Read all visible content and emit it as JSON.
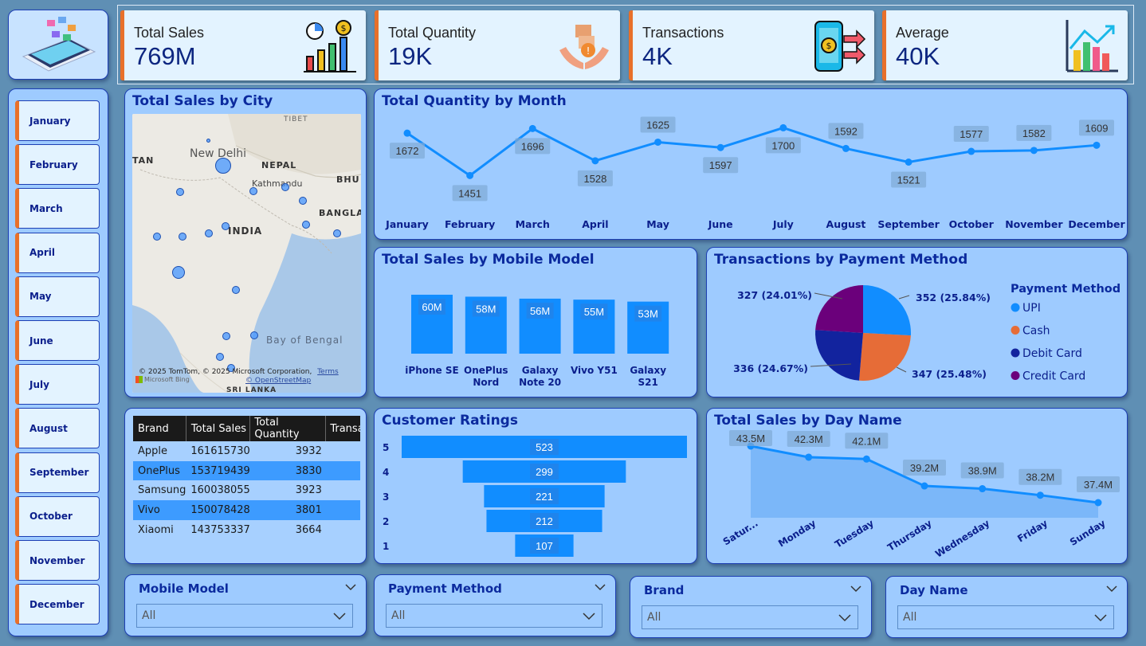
{
  "kpis": [
    {
      "label": "Total Sales",
      "value": "769M",
      "icon": "sales-bar-chart-icon"
    },
    {
      "label": "Total Quantity",
      "value": "19K",
      "icon": "package-hands-icon"
    },
    {
      "label": "Transactions",
      "value": "4K",
      "icon": "phone-payment-icon"
    },
    {
      "label": "Average",
      "value": "40K",
      "icon": "growth-chart-icon"
    }
  ],
  "months": [
    "January",
    "February",
    "March",
    "April",
    "May",
    "June",
    "July",
    "August",
    "September",
    "October",
    "November",
    "December"
  ],
  "city_map": {
    "title": "Total Sales by City",
    "labels": [
      "TIBET",
      "New Delhi",
      "TAN",
      "NEPAL",
      "Kathmandu",
      "BHU",
      "BANGLA",
      "INDIA",
      "Bay of Bengal",
      "SRI LANKA"
    ],
    "attribution": "© 2025 TomTom, © 2025 Microsoft Corporation,",
    "terms": "Terms",
    "osm": "© OpenStreetMap",
    "bing": "Microsoft Bing"
  },
  "qty_by_month": {
    "title": "Total Quantity by Month",
    "chart_data": {
      "type": "line",
      "categories": [
        "January",
        "February",
        "March",
        "April",
        "May",
        "June",
        "July",
        "August",
        "September",
        "October",
        "November",
        "December"
      ],
      "values": [
        1672,
        1451,
        1696,
        1528,
        1625,
        1597,
        1700,
        1592,
        1521,
        1577,
        1582,
        1609
      ]
    }
  },
  "sales_by_model": {
    "title": "Total Sales by Mobile Model",
    "chart_data": {
      "type": "bar",
      "categories": [
        "iPhone SE",
        "OnePlus Nord",
        "Galaxy Note 20",
        "Vivo Y51",
        "Galaxy S21"
      ],
      "values": [
        60,
        58,
        56,
        55,
        53
      ],
      "labels": [
        "60M",
        "58M",
        "56M",
        "55M",
        "53M"
      ],
      "cat_lines": [
        [
          "iPhone SE"
        ],
        [
          "OnePlus",
          "Nord"
        ],
        [
          "Galaxy",
          "Note 20"
        ],
        [
          "Vivo Y51"
        ],
        [
          "Galaxy",
          "S21"
        ]
      ]
    }
  },
  "payment": {
    "title": "Transactions by Payment Method",
    "legend_title": "Payment Method",
    "chart_data": {
      "type": "pie",
      "categories": [
        "UPI",
        "Cash",
        "Debit Card",
        "Credit Card"
      ],
      "values": [
        352,
        347,
        336,
        327
      ],
      "labels": [
        "352 (25.84%)",
        "347 (25.48%)",
        "336 (24.67%)",
        "327 (24.01%)"
      ],
      "colors": [
        "#118dff",
        "#e66c37",
        "#12239e",
        "#6b007b"
      ]
    }
  },
  "brand_table": {
    "headers": [
      "Brand",
      "Total Sales",
      "Total Quantity",
      "Transa"
    ],
    "rows": [
      [
        "Apple",
        "161615730",
        "3932"
      ],
      [
        "OnePlus",
        "153719439",
        "3830"
      ],
      [
        "Samsung",
        "160038055",
        "3923"
      ],
      [
        "Vivo",
        "150078428",
        "3801"
      ],
      [
        "Xiaomi",
        "143753337",
        "3664"
      ]
    ]
  },
  "ratings": {
    "title": "Customer Ratings",
    "chart_data": {
      "type": "bar",
      "categories": [
        "5",
        "4",
        "3",
        "2",
        "1"
      ],
      "values": [
        523,
        299,
        221,
        212,
        107
      ]
    }
  },
  "sales_by_day": {
    "title": "Total Sales by Day Name",
    "chart_data": {
      "type": "area",
      "categories": [
        "Satur...",
        "Monday",
        "Tuesday",
        "Thursday",
        "Wednesday",
        "Friday",
        "Sunday"
      ],
      "values": [
        43.5,
        42.3,
        42.1,
        39.2,
        38.9,
        38.2,
        37.4
      ],
      "labels": [
        "43.5M",
        "42.3M",
        "42.1M",
        "39.2M",
        "38.9M",
        "38.2M",
        "37.4M"
      ]
    }
  },
  "slicers": [
    {
      "label": "Mobile Model",
      "value": "All"
    },
    {
      "label": "Payment Method",
      "value": "All"
    },
    {
      "label": "Brand",
      "value": "All"
    },
    {
      "label": "Day Name",
      "value": "All"
    }
  ]
}
